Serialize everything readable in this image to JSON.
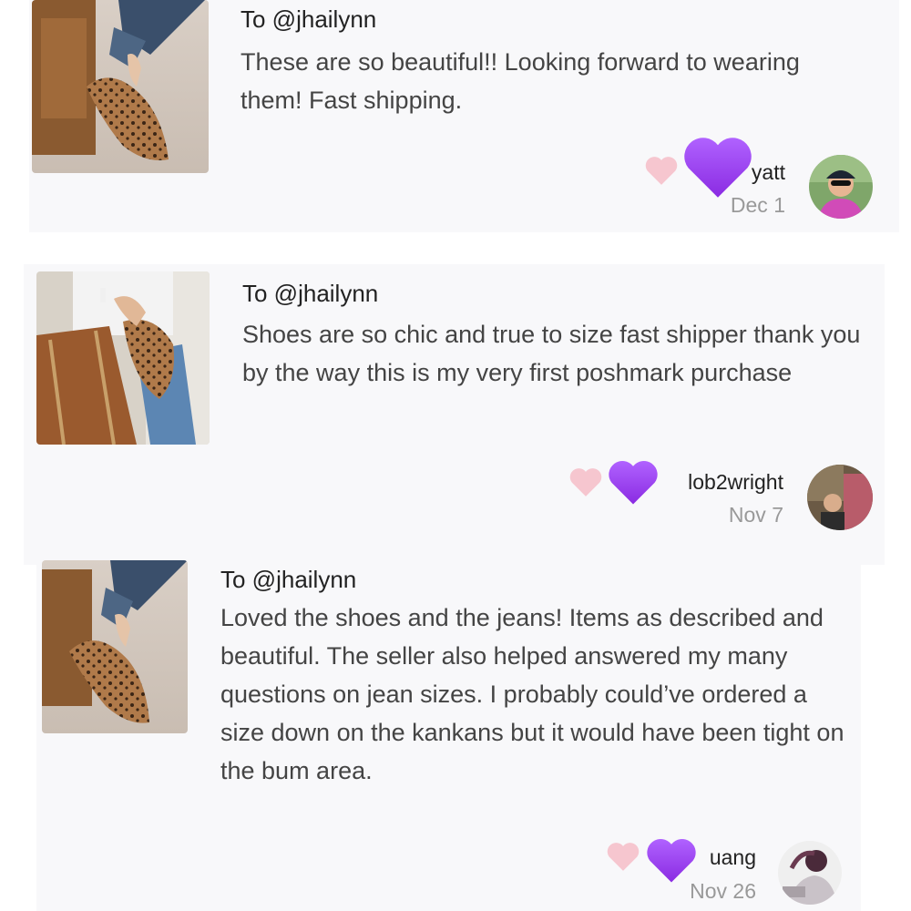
{
  "reviews": [
    {
      "recipient": "To @jhailynn",
      "message": "These are so beautiful!! Looking forward to wearing them! Fast shipping.",
      "username": "    yatt",
      "date": "Dec 1",
      "thumbnail_icon": "leopard-flats-photo",
      "avatar_icon": "user-avatar-cap-sunglasses"
    },
    {
      "recipient": "To @jhailynn",
      "message": "Shoes are so chic and true to size fast shipper thank you by the way this is my very first poshmark purchase",
      "username": "lob2wright",
      "date": "Nov 7",
      "thumbnail_icon": "leopard-flats-handbag-photo",
      "avatar_icon": "user-avatar-photo"
    },
    {
      "recipient": "To @jhailynn",
      "message": "Loved the shoes and the jeans! Items as described and beautiful. The seller also helped answered my many questions on jean sizes. I probably could’ve ordered a size down on the kankans but it would have been tight on the bum area.",
      "username": "uang",
      "date": "Nov 26",
      "thumbnail_icon": "leopard-flats-photo",
      "avatar_icon": "user-avatar-photo"
    }
  ],
  "colors": {
    "like_heart": "#f6c6cf",
    "sticker_heart": "#9b3ff0",
    "card_background": "#f8f8fa",
    "date_text": "#999999"
  },
  "icons": {
    "like": "like-heart-icon",
    "sticker": "purple-heart-sticker"
  }
}
